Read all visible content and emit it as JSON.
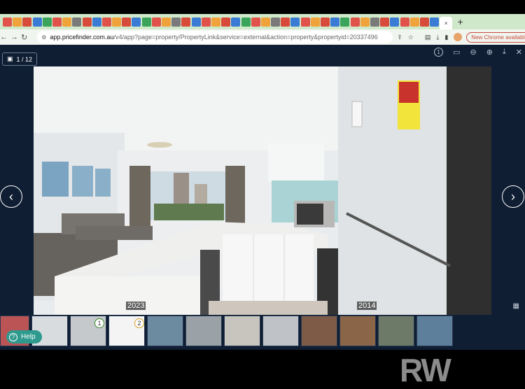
{
  "browser": {
    "url_domain": "app.pricefinder.com.au",
    "url_path": "/v4/app?page=property/PropertyLink&service=external&action=property&propertyid=20337496",
    "new_chrome_label": "New Chrome available",
    "tab_add": "+",
    "tab_close": "×",
    "nav_back": "←",
    "nav_forward": "→",
    "nav_reload": "↻"
  },
  "viewer": {
    "counter": "1 / 12",
    "year_label_left": "2023",
    "year_label_right": "2014",
    "prev_arrow": "‹",
    "next_arrow": "›",
    "help_label": "Help",
    "watermark": "RW",
    "thumb_badge_1": "1",
    "thumb_badge_2": "2",
    "tools": [
      "1",
      "▭",
      "⊖",
      "⊕",
      "⤓",
      "✕"
    ]
  },
  "colors": {
    "viewer_bg": "#0f1e33",
    "tabbar_bg": "#cfe8c9",
    "help_bg": "#2e9a8e",
    "new_chrome": "#c94b3e"
  }
}
